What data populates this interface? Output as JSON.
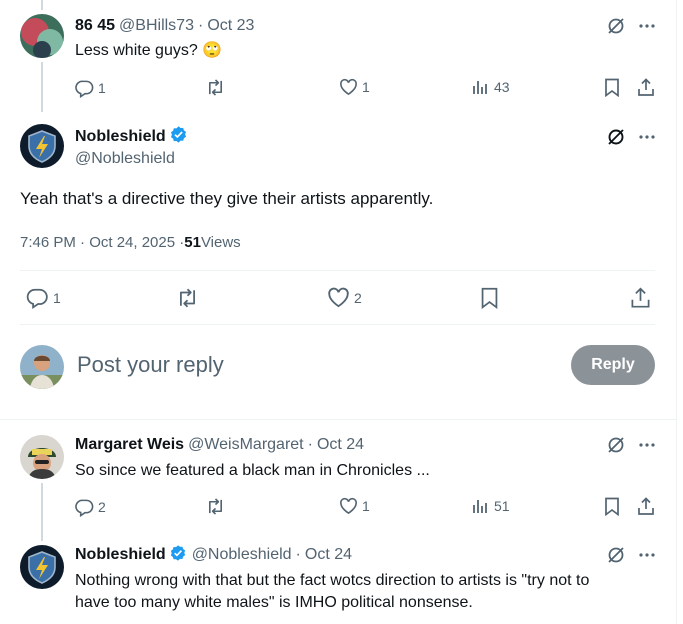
{
  "tweets": {
    "t1": {
      "name": "86 45",
      "handle": "@BHills73",
      "sep": "·",
      "date": "Oct 23",
      "text": "Less white guys? 🙄",
      "replies": "1",
      "likes": "1",
      "views": "43"
    },
    "main": {
      "name": "Nobleshield",
      "handle": "@Nobleshield",
      "text": "Yeah that's a directive they give their artists apparently.",
      "time": "7:46 PM · Oct 24, 2025 · ",
      "views_count": "51",
      "views_label": " Views",
      "replies": "1",
      "likes": "2"
    },
    "t3": {
      "name": "Margaret Weis",
      "handle": "@WeisMargaret",
      "sep": "·",
      "date": "Oct 24",
      "text": "So since we featured a black man in Chronicles ...",
      "replies": "2",
      "likes": "1",
      "views": "51"
    },
    "t4": {
      "name": "Nobleshield",
      "handle": "@Nobleshield",
      "sep": "·",
      "date": "Oct 24",
      "text_line1": "Nothing wrong with that but the fact wotcs direction to artists is \"try not to",
      "text_line2": "have too many white males\" is IMHO political nonsense."
    }
  },
  "composer": {
    "placeholder": "Post your reply",
    "button": "Reply"
  },
  "colors": {
    "verified": "#1d9bf0",
    "muted": "#536471",
    "reply_button_disabled": "#8b9298"
  }
}
